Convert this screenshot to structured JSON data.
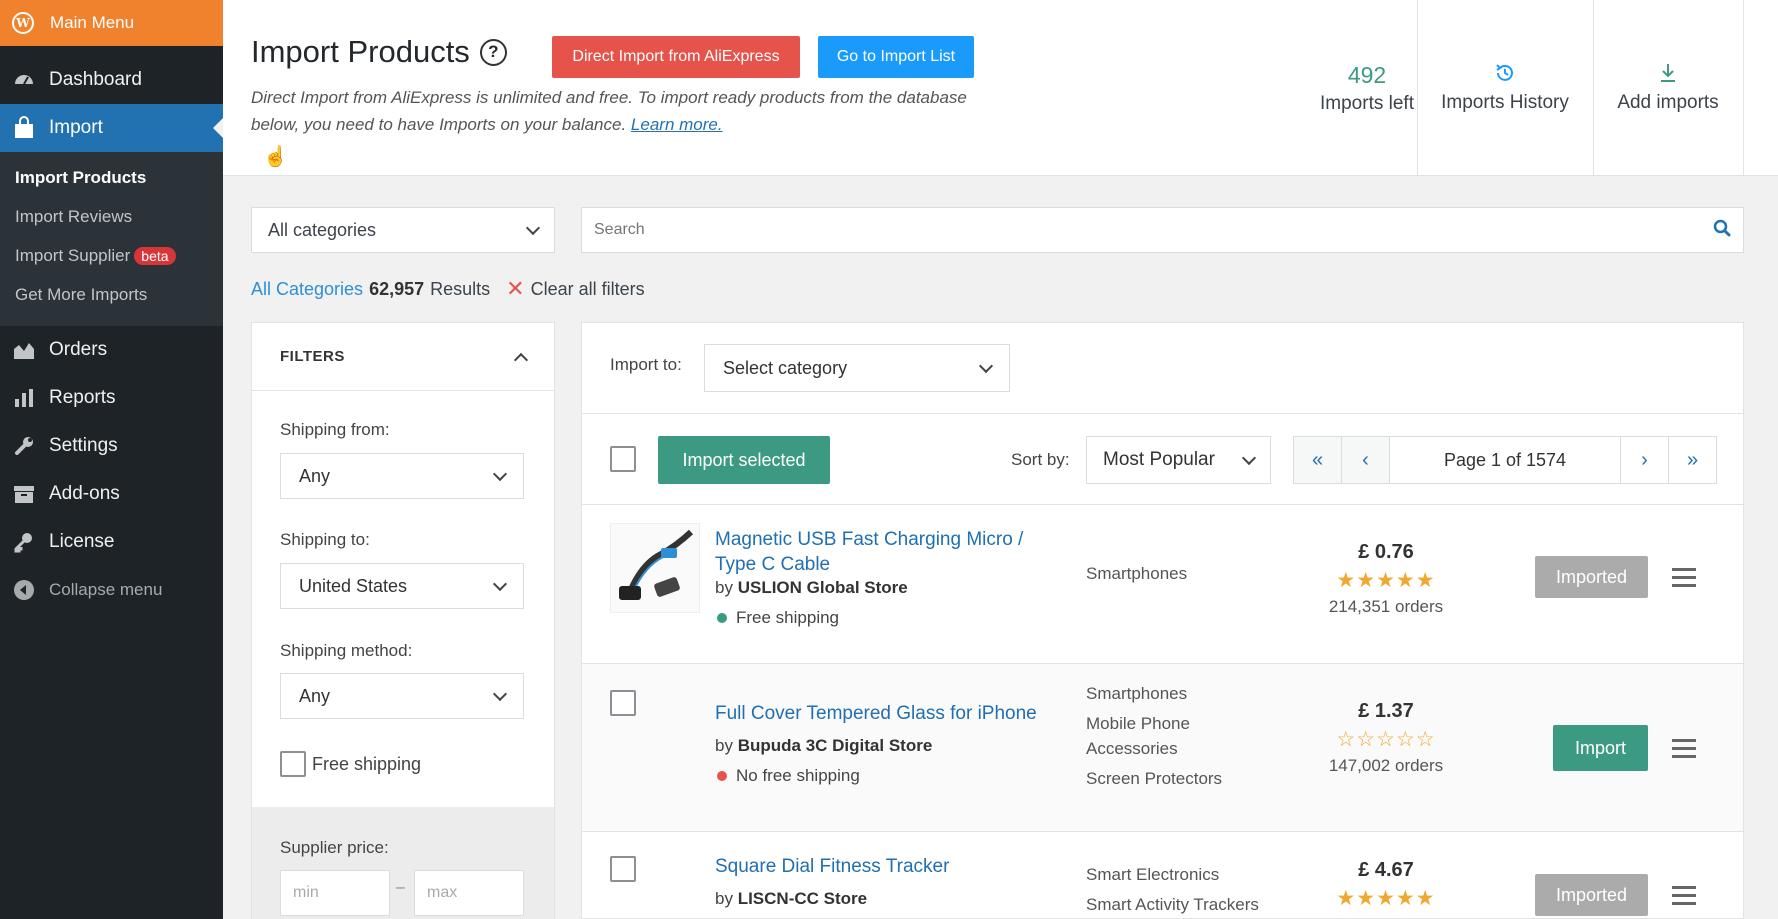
{
  "sidebar": {
    "top_label": "Main Menu",
    "items": [
      {
        "label": "Dashboard"
      },
      {
        "label": "Import"
      },
      {
        "label": "Orders"
      },
      {
        "label": "Reports"
      },
      {
        "label": "Settings"
      },
      {
        "label": "Add-ons"
      },
      {
        "label": "License"
      },
      {
        "label": "Collapse menu"
      }
    ],
    "submenu": [
      {
        "label": "Import Products"
      },
      {
        "label": "Import Reviews"
      },
      {
        "label": "Import Supplier",
        "badge": "beta"
      },
      {
        "label": "Get More Imports"
      }
    ]
  },
  "header": {
    "title": "Import Products",
    "help": "?",
    "btn_direct": "Direct Import from AliExpress",
    "btn_list": "Go to Import List",
    "desc_line1": "Direct Import from AliExpress is unlimited and free. To import ready products from the database",
    "desc_line2": "below, you need to have Imports on your balance.",
    "learn_more": "Learn more.",
    "imports_left_value": "492",
    "imports_left_label": "Imports left",
    "history_label": "Imports History",
    "add_label": "Add imports"
  },
  "search": {
    "category": "All categories",
    "placeholder": "Search"
  },
  "results": {
    "category_link": "All Categories",
    "count": "62,957",
    "suffix": "Results",
    "clear": "Clear all filters"
  },
  "filters": {
    "title": "FILTERS",
    "shipping_from_label": "Shipping from:",
    "shipping_from_value": "Any",
    "shipping_to_label": "Shipping to:",
    "shipping_to_value": "United States",
    "shipping_method_label": "Shipping method:",
    "shipping_method_value": "Any",
    "free_shipping_label": "Free shipping",
    "supplier_price_label": "Supplier price:",
    "min_placeholder": "min",
    "max_placeholder": "max",
    "price_sep": "–"
  },
  "panel": {
    "import_to_label": "Import to:",
    "import_to_value": "Select category",
    "import_selected": "Import selected",
    "sort_label": "Sort by:",
    "sort_value": "Most Popular",
    "page_text": "Page 1 of 1574"
  },
  "products": [
    {
      "title_l1": "Magnetic USB Fast Charging Micro /",
      "title_l2": "Type C Cable",
      "by": "by",
      "store": "USLION Global Store",
      "shipping": "Free shipping",
      "shipping_color": "#3d9a82",
      "cat1": "Smartphones",
      "price": "£ 0.76",
      "stars": "★★★★★",
      "orders": "214,351 orders",
      "action": "Imported"
    },
    {
      "title_l1": "Full Cover Tempered Glass for iPhone",
      "by": "by",
      "store": "Bupuda 3C Digital Store",
      "shipping": "No free shipping",
      "shipping_color": "#e5534b",
      "cat1": "Smartphones",
      "cat2": "Mobile Phone Accessories",
      "cat3": "Screen Protectors",
      "price": "£ 1.37",
      "stars": "☆☆☆☆☆",
      "orders": "147,002 orders",
      "action": "Import"
    },
    {
      "title_l1": "Square Dial Fitness Tracker",
      "by": "by",
      "store": "LISCN-CC Store",
      "cat1": "Smart Electronics",
      "cat2": "Smart Activity Trackers",
      "price": "£ 4.67",
      "stars": "★★★★★",
      "action": "Imported"
    }
  ],
  "colors": {
    "sidebar": "#1d2327",
    "accent_orange": "#f0822e",
    "accent_blue": "#2271b1",
    "green": "#3d9a82",
    "red": "#e5534b"
  }
}
